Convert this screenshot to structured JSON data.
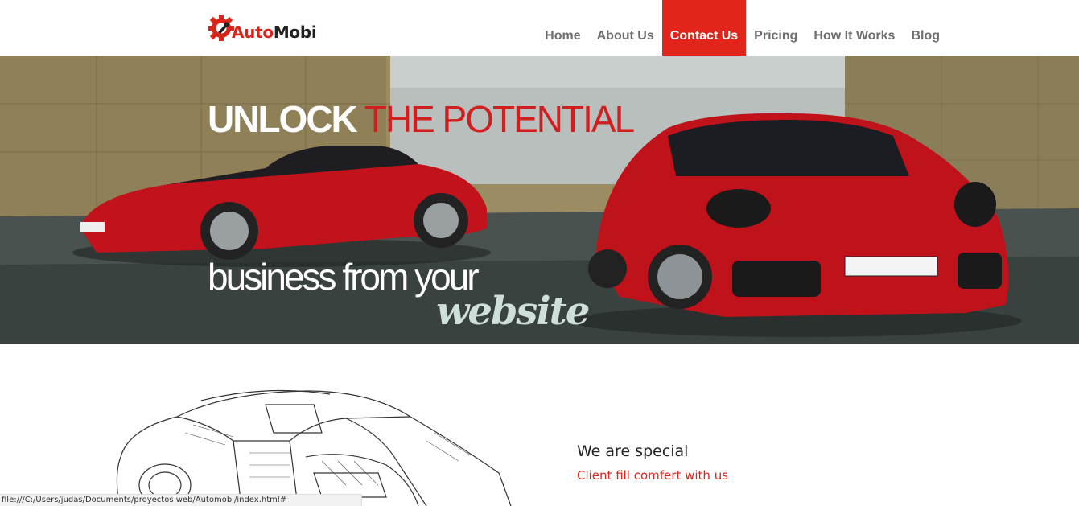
{
  "brand": {
    "name_part1": "Auto",
    "name_part2": "Mobi",
    "logo_icon": "wrench-gear-icon",
    "accent": "#e1251b"
  },
  "nav": {
    "items": [
      {
        "label": "Home"
      },
      {
        "label": "About Us"
      },
      {
        "label": "Contact Us",
        "active": true
      },
      {
        "label": "Pricing"
      },
      {
        "label": "How It Works"
      },
      {
        "label": "Blog"
      }
    ]
  },
  "hero": {
    "line1_bold": "UNLOCK",
    "line1_red": "THE POTENTIAL",
    "line2": "business from your",
    "line3": "website"
  },
  "section": {
    "title": "We are special",
    "subtitle": "Client fill comfert with us"
  },
  "statusbar": {
    "url": "file:///C:/Users/judas/Documents/proyectos web/Automobi/index.html#"
  }
}
